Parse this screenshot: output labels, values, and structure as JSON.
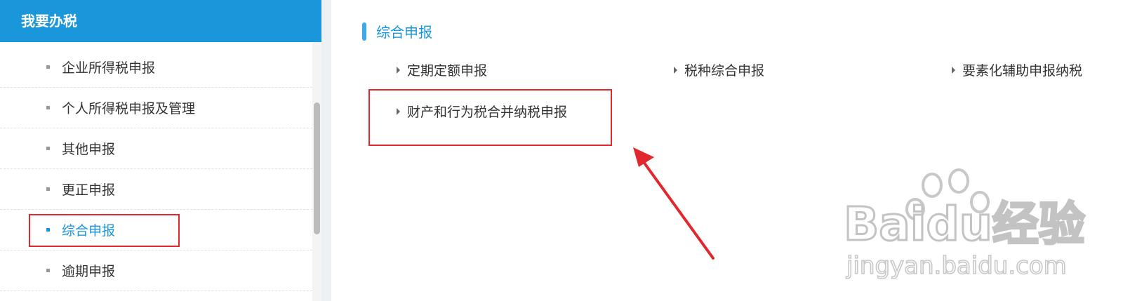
{
  "sidebar": {
    "title": "我要办税",
    "items": [
      {
        "label": "企业所得税申报"
      },
      {
        "label": "个人所得税申报及管理"
      },
      {
        "label": "其他申报"
      },
      {
        "label": "更正申报"
      },
      {
        "label": "综合申报",
        "active": true
      },
      {
        "label": "逾期申报"
      }
    ]
  },
  "main": {
    "section_title": "综合申报",
    "links": [
      {
        "label": "定期定额申报"
      },
      {
        "label": "税种综合申报"
      },
      {
        "label": "要素化辅助申报纳税"
      },
      {
        "label": "财产和行为税合并纳税申报"
      }
    ]
  },
  "watermark": {
    "brand": "Baidu经验",
    "url": "jingyan.baidu.com"
  },
  "colors": {
    "accent": "#1a96da",
    "highlight": "#e1282e"
  }
}
